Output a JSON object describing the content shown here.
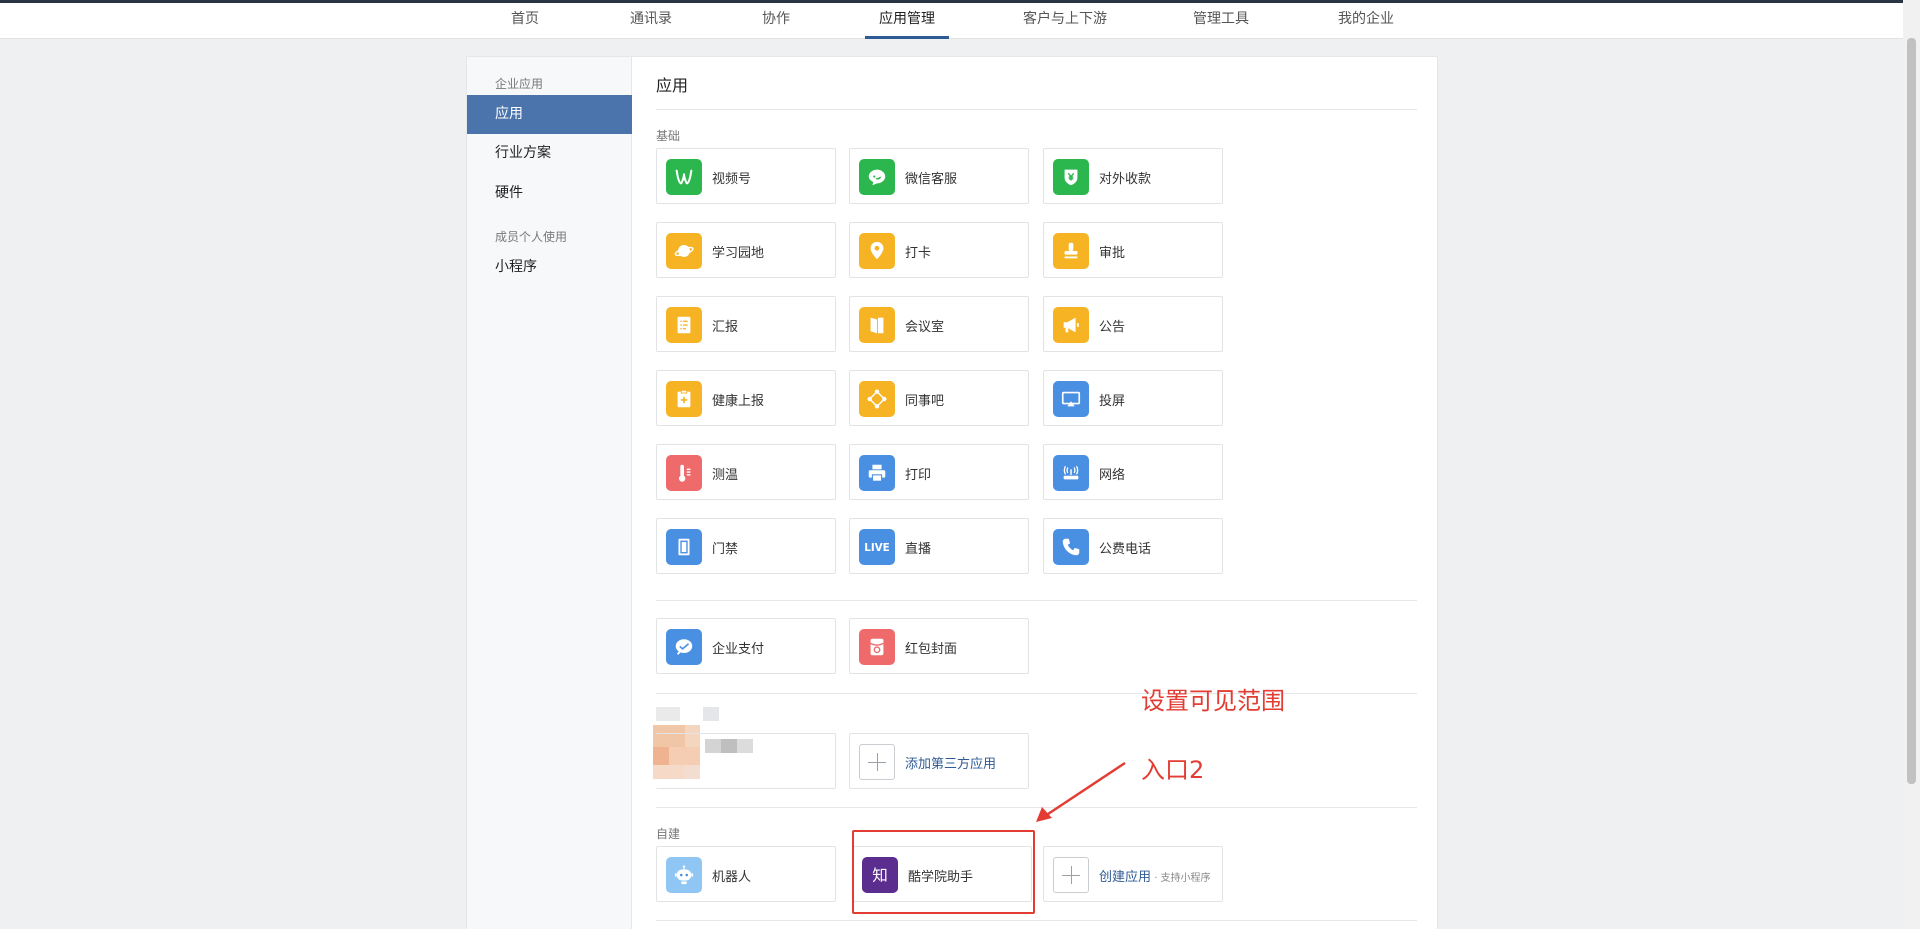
{
  "nav": {
    "items": [
      {
        "label": "首页",
        "active": false
      },
      {
        "label": "通讯录",
        "active": false
      },
      {
        "label": "协作",
        "active": false
      },
      {
        "label": "应用管理",
        "active": true
      },
      {
        "label": "客户与上下游",
        "active": false
      },
      {
        "label": "管理工具",
        "active": false
      },
      {
        "label": "我的企业",
        "active": false
      }
    ]
  },
  "sidebar": {
    "group1": "企业应用",
    "items1": [
      "应用",
      "行业方案",
      "硬件"
    ],
    "group2": "成员个人使用",
    "items2": [
      "小程序"
    ]
  },
  "content": {
    "title": "应用",
    "section_basic": "基础",
    "basic_apps": [
      {
        "label": "视频号",
        "color": "#2bb64e",
        "icon": "channels-icon"
      },
      {
        "label": "微信客服",
        "color": "#2bb64e",
        "icon": "chat-bubble-icon"
      },
      {
        "label": "对外收款",
        "color": "#2bb64e",
        "icon": "yuan-shield-icon"
      },
      {
        "label": "学习园地",
        "color": "#f6b324",
        "icon": "planet-icon"
      },
      {
        "label": "打卡",
        "color": "#f6b324",
        "icon": "location-pin-icon"
      },
      {
        "label": "审批",
        "color": "#f6b324",
        "icon": "stamp-icon"
      },
      {
        "label": "汇报",
        "color": "#f6b324",
        "icon": "report-doc-icon"
      },
      {
        "label": "会议室",
        "color": "#f6b324",
        "icon": "door-icon"
      },
      {
        "label": "公告",
        "color": "#f6b324",
        "icon": "megaphone-icon"
      },
      {
        "label": "健康上报",
        "color": "#f6b324",
        "icon": "clipboard-plus-icon"
      },
      {
        "label": "同事吧",
        "color": "#f6b324",
        "icon": "network-nodes-icon"
      },
      {
        "label": "投屏",
        "color": "#4a90e2",
        "icon": "cast-screen-icon"
      },
      {
        "label": "测温",
        "color": "#ef6a6a",
        "icon": "thermometer-icon"
      },
      {
        "label": "打印",
        "color": "#4a90e2",
        "icon": "printer-icon"
      },
      {
        "label": "网络",
        "color": "#4a90e2",
        "icon": "router-icon"
      },
      {
        "label": "门禁",
        "color": "#4a90e2",
        "icon": "access-door-icon"
      },
      {
        "label": "直播",
        "color": "#4a90e2",
        "icon": "live-icon",
        "text": "LIVE"
      },
      {
        "label": "公费电话",
        "color": "#4a90e2",
        "icon": "phone-icon"
      }
    ],
    "pay_apps": [
      {
        "label": "企业支付",
        "color": "#4a90e2",
        "icon": "payment-icon"
      },
      {
        "label": "红包封面",
        "color": "#ef6a6a",
        "icon": "red-packet-icon"
      }
    ],
    "add_third_party": "添加第三方应用",
    "section_custom": "自建",
    "custom_apps": [
      {
        "label": "机器人",
        "color": "#8fc6f4",
        "icon": "robot-icon"
      },
      {
        "label": "酷学院助手",
        "color": "#5b2d8e",
        "icon": "zhi-logo-icon",
        "text": "知"
      }
    ],
    "create_app": "创建应用",
    "create_app_sub": " · 支持小程序"
  },
  "annotations": {
    "title": "设置可见范围",
    "entry": "入口2",
    "color": "#e23c33"
  }
}
